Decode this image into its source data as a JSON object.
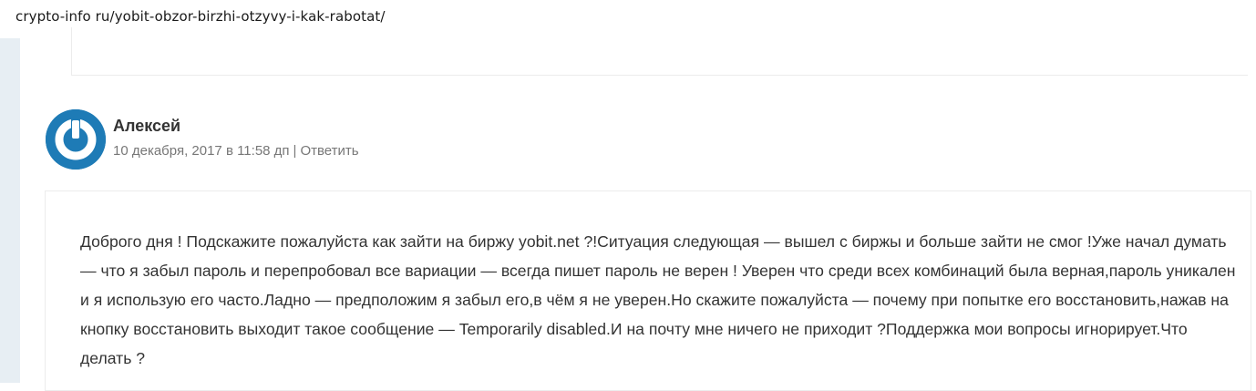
{
  "browser": {
    "url": "crypto-info ru/yobit-obzor-birzhi-otzyvy-i-kak-rabotat/"
  },
  "comment": {
    "author": "Алексей",
    "date": "10 декабря, 2017 в 11:58 дп",
    "separator": "|",
    "reply_label": "Ответить",
    "avatar_icon": "power-button-icon",
    "text": "Доброго дня ! Подскажите пожалуйста как зайти на биржу yobit.net ?!Ситуация следующая — вышел с биржы и больше зайти не смог !Уже начал думать — что я забыл пароль и перепробовал все вариации — всегда пишет пароль не верен ! Уверен что среди всех комбинаций была верная,пароль уникален и я использую его часто.Ладно — предположим я забыл его,в чём я не уверен.Но скажите пожалуйста — почему при попытке его восстановить,нажав на кнопку восстановить выходит такое сообщение — Temporarily disabled.И на почту мне ничего не приходит ?Поддержка мои вопросы игнорирует.Что делать ?"
  },
  "colors": {
    "avatar_bg": "#1e7bb6",
    "text": "#333333",
    "meta": "#777777",
    "rail": "#e7eef3"
  }
}
